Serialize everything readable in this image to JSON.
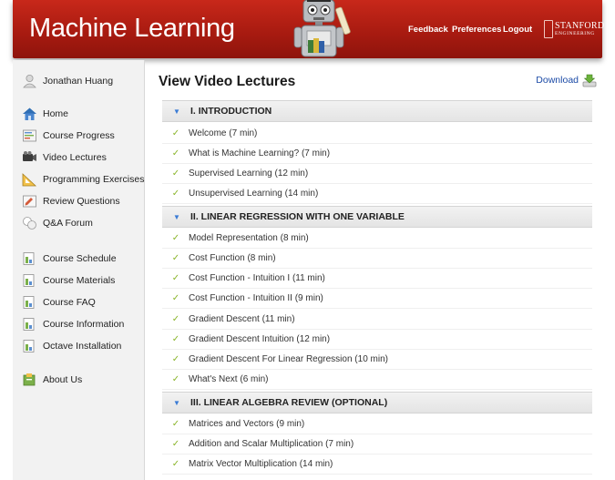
{
  "header": {
    "title": "Machine Learning",
    "links": [
      "Feedback",
      "Preferences",
      "Logout"
    ],
    "logo_name": "STANFORD",
    "logo_sub": "ENGINEERING",
    "accent_color": "#b3201a"
  },
  "sidebar": {
    "user": "Jonathan Huang",
    "nav": [
      {
        "label": "Home",
        "icon": "home-icon"
      },
      {
        "label": "Course Progress",
        "icon": "course-progress-icon"
      },
      {
        "label": "Video Lectures",
        "icon": "video-camera-icon"
      },
      {
        "label": "Programming Exercises",
        "icon": "programming-exercises-icon"
      },
      {
        "label": "Review Questions",
        "icon": "review-questions-icon"
      },
      {
        "label": "Q&A Forum",
        "icon": "forum-icon"
      },
      {
        "label": "Course Schedule",
        "icon": "document-icon"
      },
      {
        "label": "Course Materials",
        "icon": "document-icon"
      },
      {
        "label": "Course FAQ",
        "icon": "document-icon"
      },
      {
        "label": "Course Information",
        "icon": "document-icon"
      },
      {
        "label": "Octave Installation",
        "icon": "document-icon"
      },
      {
        "label": "About Us",
        "icon": "about-us-icon"
      }
    ]
  },
  "main": {
    "title": "View Video Lectures",
    "download_label": "Download",
    "sections": [
      {
        "title": "I. INTRODUCTION",
        "lectures": [
          "Welcome (7 min)",
          "What is Machine Learning? (7 min)",
          "Supervised Learning (12 min)",
          "Unsupervised Learning (14 min)"
        ]
      },
      {
        "title": "II. LINEAR REGRESSION WITH ONE VARIABLE",
        "lectures": [
          "Model Representation (8 min)",
          "Cost Function (8 min)",
          "Cost Function - Intuition I (11 min)",
          "Cost Function - Intuition II (9 min)",
          "Gradient Descent (11 min)",
          "Gradient Descent Intuition (12 min)",
          "Gradient Descent For Linear Regression (10 min)",
          "What's Next (6 min)"
        ]
      },
      {
        "title": "III. LINEAR ALGEBRA REVIEW (OPTIONAL)",
        "lectures": [
          "Matrices and Vectors (9 min)",
          "Addition and Scalar Multiplication (7 min)",
          "Matrix Vector Multiplication (14 min)"
        ]
      }
    ]
  }
}
